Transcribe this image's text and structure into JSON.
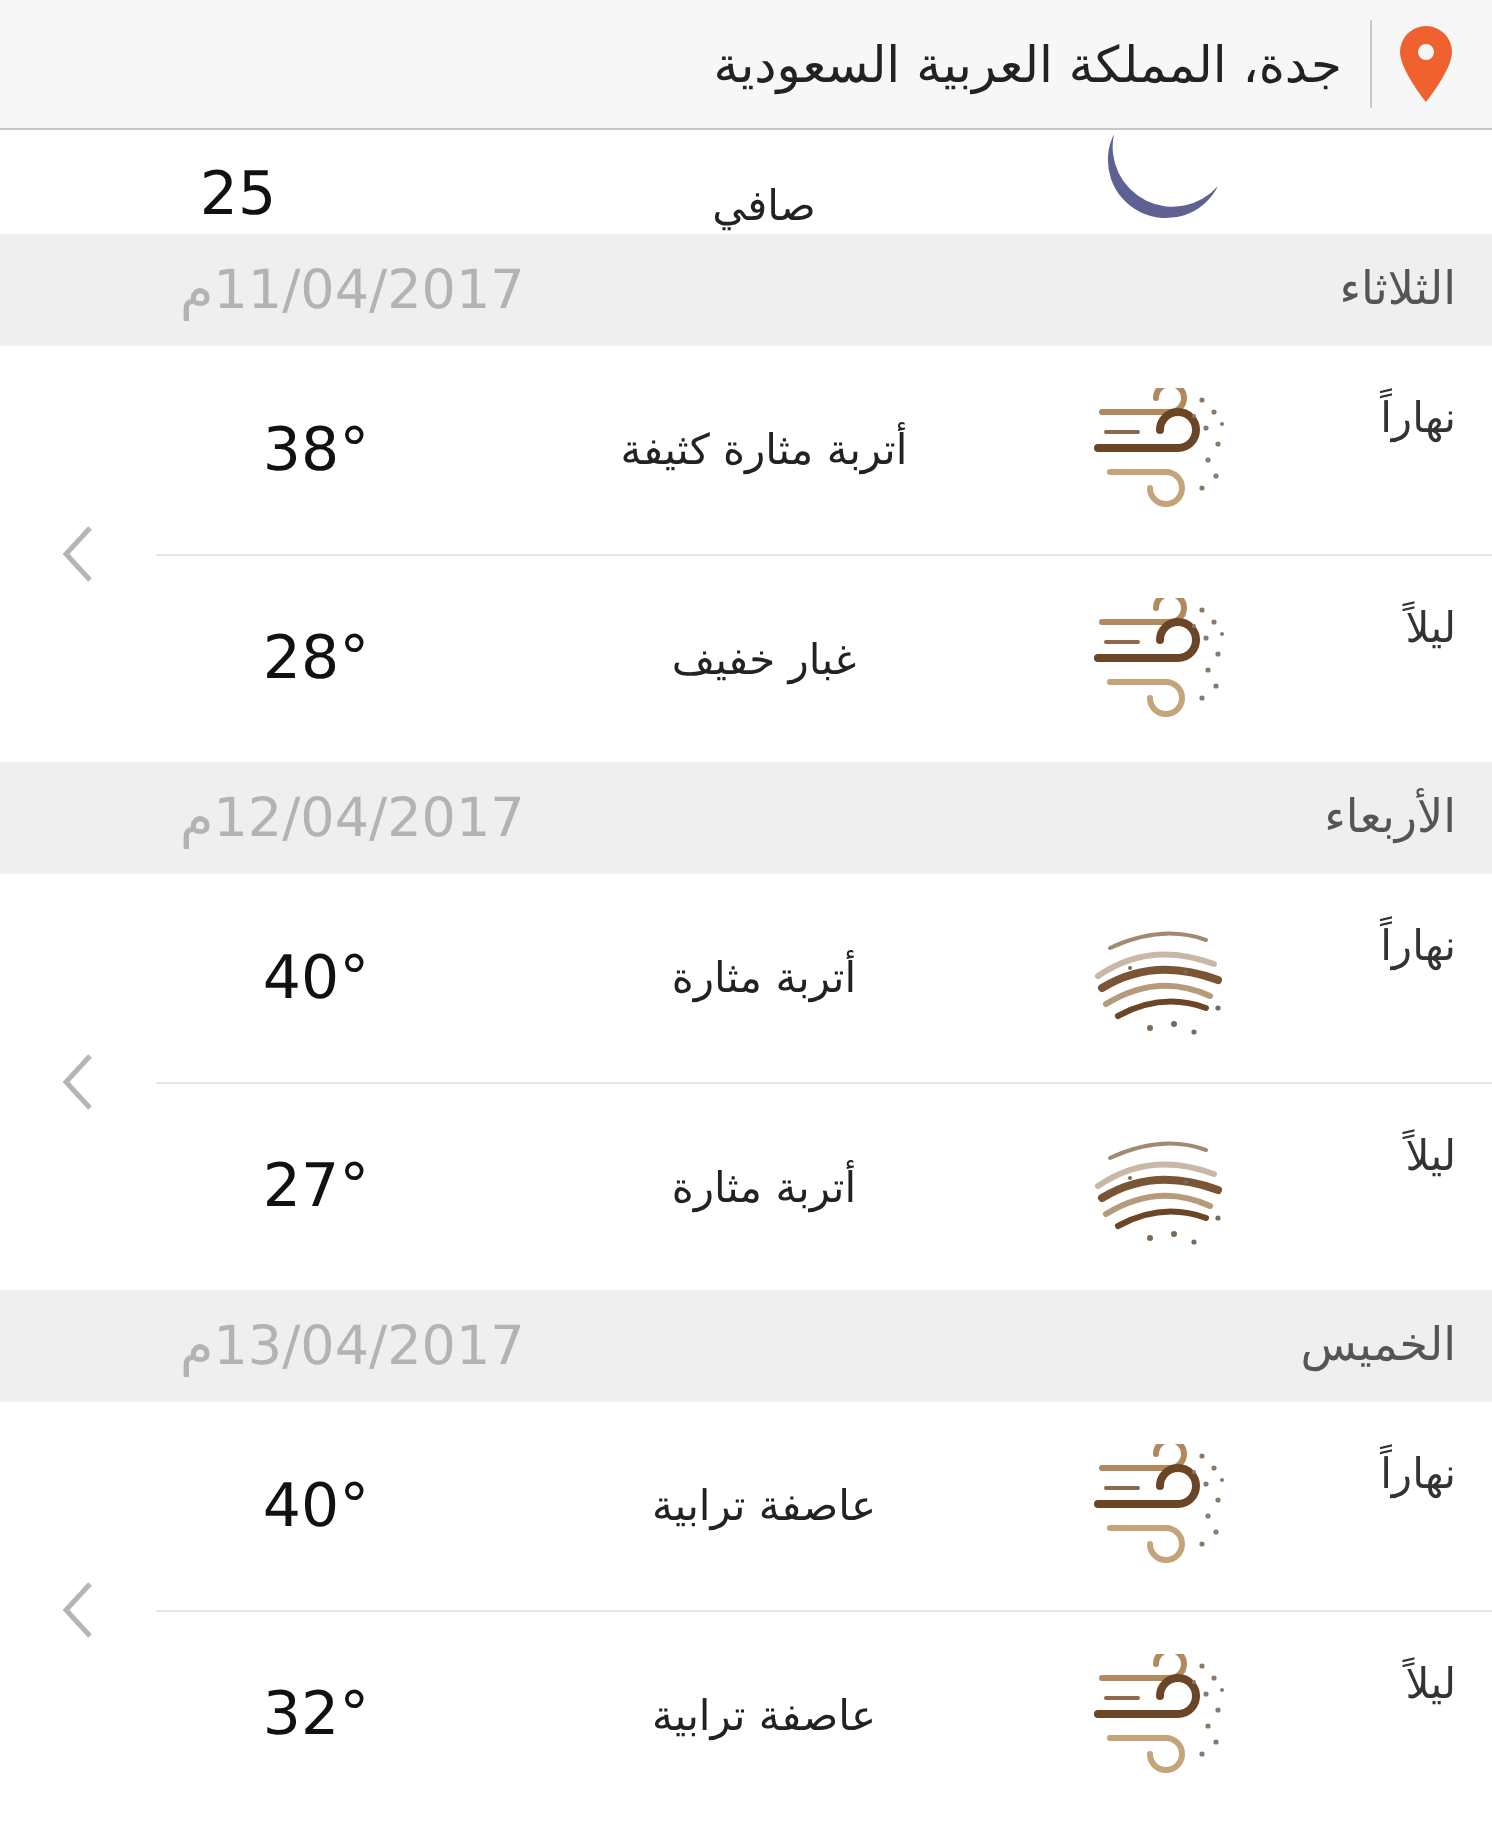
{
  "header": {
    "location": "جدة، المملكة العربية السعودية"
  },
  "partial_row": {
    "kind": "moon",
    "condition": "صافي",
    "temperature": "25"
  },
  "days": [
    {
      "day": "الثلاثاء",
      "date": "11/04/2017م",
      "periods": [
        {
          "label": "نهاراً",
          "kind": "dust",
          "condition": "أتربة مثارة كثيفة",
          "temperature": "38°"
        },
        {
          "label": "ليلاً",
          "kind": "dust",
          "condition": "غبار خفيف",
          "temperature": "28°"
        }
      ]
    },
    {
      "day": "الأربعاء",
      "date": "12/04/2017م",
      "periods": [
        {
          "label": "نهاراً",
          "kind": "waves",
          "condition": "أتربة مثارة",
          "temperature": "40°"
        },
        {
          "label": "ليلاً",
          "kind": "waves",
          "condition": "أتربة مثارة",
          "temperature": "27°"
        }
      ]
    },
    {
      "day": "الخميس",
      "date": "13/04/2017م",
      "periods": [
        {
          "label": "نهاراً",
          "kind": "dust",
          "condition": "عاصفة ترابية",
          "temperature": "40°"
        },
        {
          "label": "ليلاً",
          "kind": "dust",
          "condition": "عاصفة ترابية",
          "temperature": "32°"
        }
      ]
    }
  ]
}
